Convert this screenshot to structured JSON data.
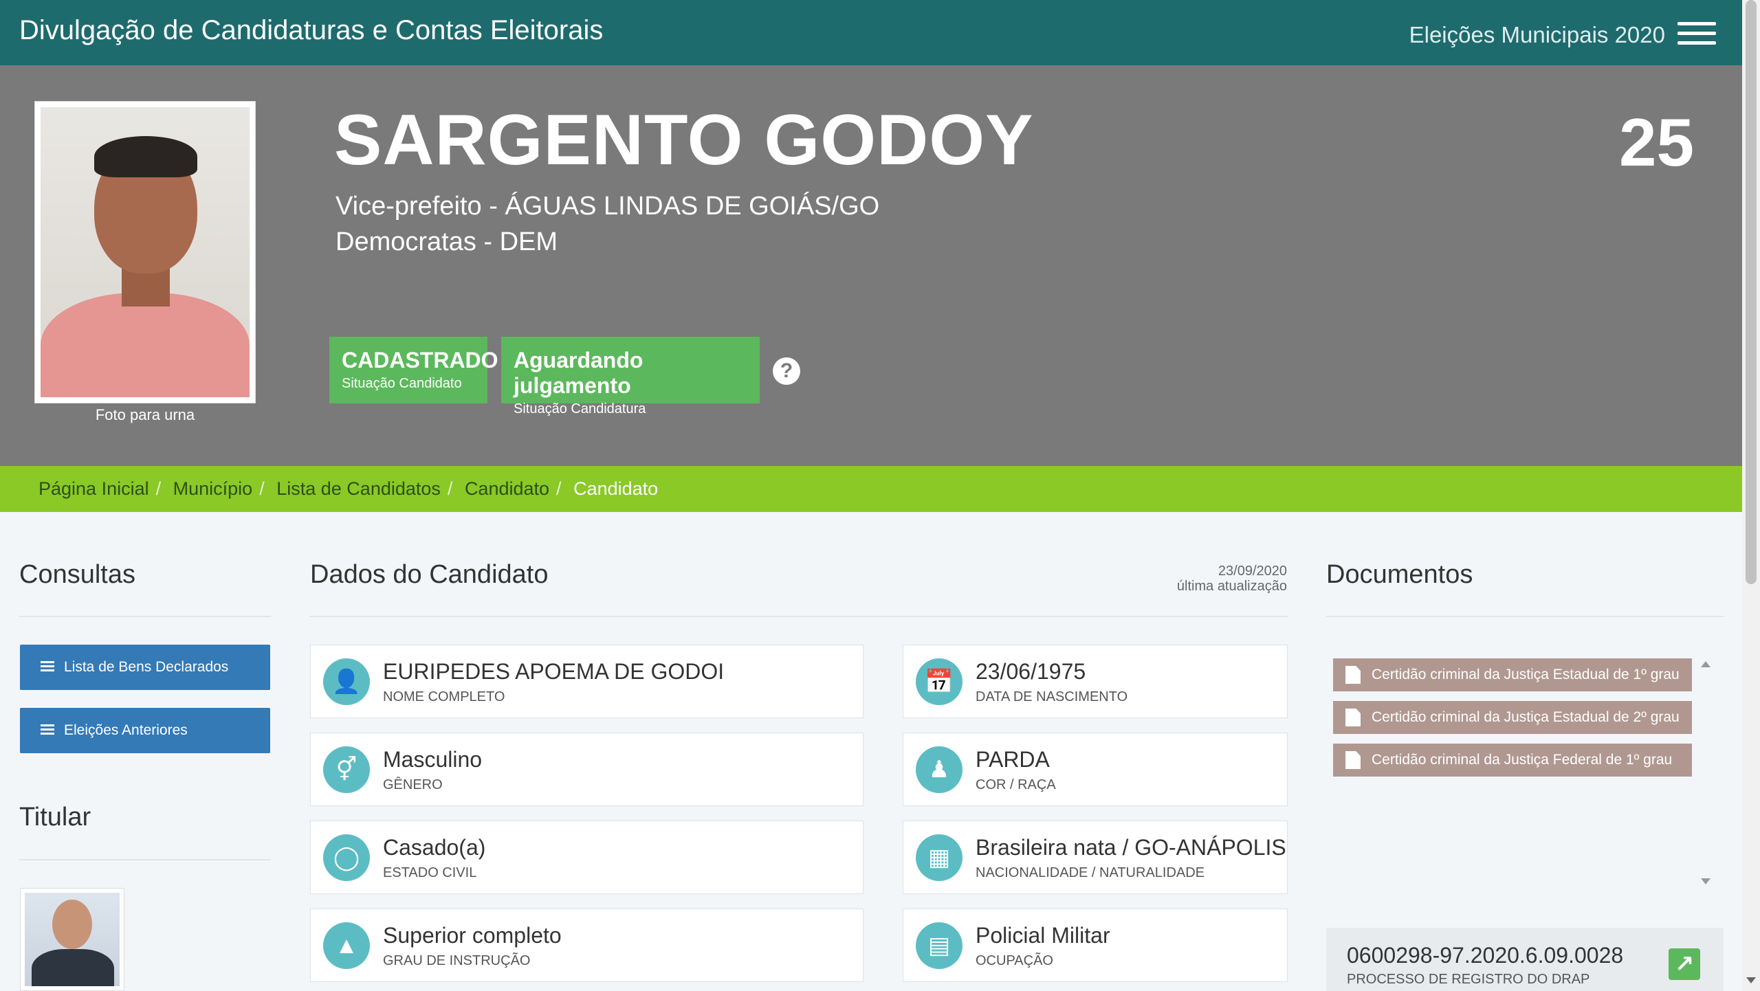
{
  "topbar": {
    "title": "Divulgação de Candidaturas e Contas Eleitorais",
    "election": "Eleições Municipais 2020"
  },
  "candidate": {
    "name": "SARGENTO GODOY",
    "number": "25",
    "role": "Vice-prefeito - ÁGUAS LINDAS DE GOIÁS/GO",
    "party": "Democratas - DEM",
    "photo_caption": "Foto para urna",
    "status": [
      {
        "value": "CADASTRADO",
        "label": "Situação Candidato"
      },
      {
        "value": "Aguardando julgamento",
        "label": "Situação Candidatura"
      }
    ]
  },
  "breadcrumb": [
    "Página Inicial",
    "Município",
    "Lista de Candidatos",
    "Candidato",
    "Candidato"
  ],
  "consultas": {
    "title": "Consultas",
    "buttons": [
      "Lista de Bens Declarados",
      "Eleições Anteriores"
    ],
    "titular_title": "Titular"
  },
  "dados": {
    "title": "Dados do Candidato",
    "updated_date": "23/09/2020",
    "updated_label": "última atualização",
    "fields": [
      {
        "value": "EURIPEDES APOEMA DE GODOI",
        "label": "Nome Completo",
        "icon": "user-icon"
      },
      {
        "value": "23/06/1975",
        "label": "Data de Nascimento",
        "icon": "calendar-icon"
      },
      {
        "value": "Masculino",
        "label": "Gênero",
        "icon": "gender-icon"
      },
      {
        "value": "PARDA",
        "label": "Cor / Raça",
        "icon": "person-icon"
      },
      {
        "value": "Casado(a)",
        "label": "Estado Civil",
        "icon": "ring-icon"
      },
      {
        "value": "Brasileira nata / GO-ANÁPOLIS",
        "label": "Nacionalidade / Naturalidade",
        "icon": "map-icon"
      },
      {
        "value": "Superior completo",
        "label": "Grau de Instrução",
        "icon": "graduation-cap-icon"
      },
      {
        "value": "Policial Militar",
        "label": "Ocupação",
        "icon": "building-icon"
      }
    ]
  },
  "documentos": {
    "title": "Documentos",
    "items": [
      "Certidão criminal da Justiça Estadual de 1º grau",
      "Certidão criminal da Justiça Estadual de 2º grau",
      "Certidão criminal da Justiça Federal de 1º grau"
    ],
    "drap_number": "0600298-97.2020.6.09.0028",
    "drap_label": "PROCESSO DE REGISTRO DO DRAP"
  }
}
